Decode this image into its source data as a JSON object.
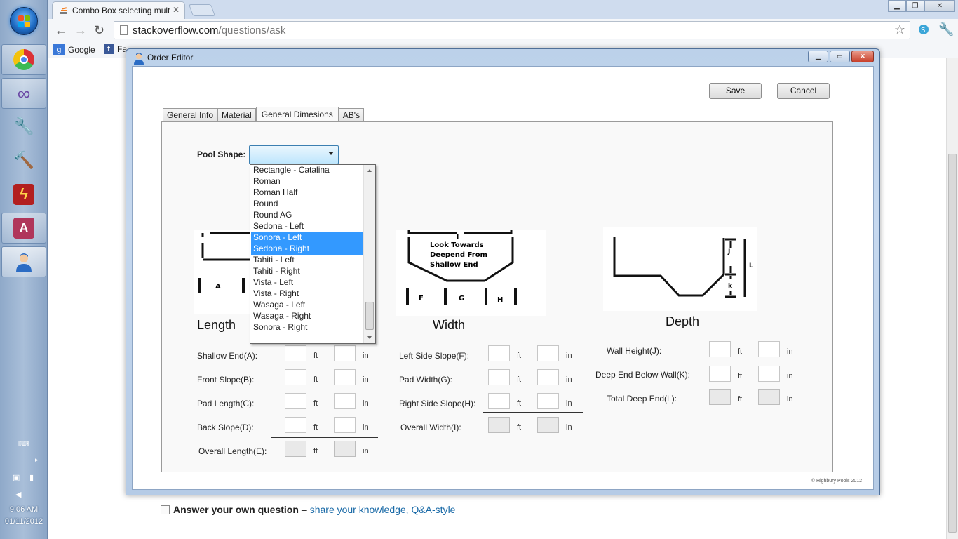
{
  "taskbar": {
    "clock_time": "9:06 AM",
    "clock_date": "01/11/2012",
    "items": [
      {
        "name": "chrome-icon",
        "color": "#e8b41c"
      },
      {
        "name": "visual-studio-icon",
        "color": "#6b4aa5"
      },
      {
        "name": "tools-icon",
        "color": "#777777"
      },
      {
        "name": "hammer-icon",
        "color": "#d58a1f"
      },
      {
        "name": "filezilla-icon",
        "color": "#b21f1f"
      },
      {
        "name": "access-icon",
        "color": "#b0365b"
      },
      {
        "name": "order-editor-app-icon",
        "color": "#2b6cc4"
      }
    ]
  },
  "browser": {
    "tab_title": "Combo Box selecting mult",
    "url_host": "stackoverflow.com",
    "url_path": "/questions/ask",
    "bookmarks": {
      "google": "Google",
      "facebook": "Fa"
    }
  },
  "page": {
    "answer_label": "Answer your own question",
    "answer_dash": "–",
    "answer_link": "share your knowledge, Q&A-style"
  },
  "dialog": {
    "title": "Order Editor",
    "save_label": "Save",
    "cancel_label": "Cancel",
    "tabs": [
      "General Info",
      "Material",
      "General Dimesions",
      "AB's"
    ],
    "active_tab": "General Dimesions",
    "pool_shape_label": "Pool Shape:",
    "pool_shape_value": "",
    "pool_shape_options": [
      "Rectangle - Catalina",
      "Roman",
      "Roman Half",
      "Round",
      "Round AG",
      "Sedona - Left",
      "Sonora - Left",
      "Sedona - Right",
      "Tahiti - Left",
      "Tahiti - Right",
      "Vista - Left",
      "Vista - Right",
      "Wasaga - Left",
      "Wasaga - Right",
      "Sonora - Right"
    ],
    "highlighted_options": [
      "Sonora - Left",
      "Sedona - Right"
    ],
    "length": {
      "title": "Length",
      "diagram_labels": [
        "A"
      ],
      "rows": [
        "Shallow End(A):",
        "Front Slope(B):",
        "Pad Length(C):",
        "Back Slope(D):"
      ],
      "total": "Overall Length(E):"
    },
    "width": {
      "title": "Width",
      "diagram_note": [
        "Look Towards",
        "Deepend From",
        "Shallow End"
      ],
      "diagram_labels": [
        "I",
        "F",
        "G",
        "H"
      ],
      "rows": [
        "Left Side Slope(F):",
        "Pad Width(G):",
        "Right Side Slope(H):"
      ],
      "total": "Overall Width(I):"
    },
    "depth": {
      "title": "Depth",
      "diagram_labels": [
        "J",
        "k",
        "L"
      ],
      "rows": [
        "Wall Height(J):",
        "Deep End Below Wall(K):"
      ],
      "total": "Total Deep End(L):"
    },
    "units": {
      "ft": "ft",
      "in": "in"
    },
    "copyright": "© Highbury Pools 2012"
  }
}
